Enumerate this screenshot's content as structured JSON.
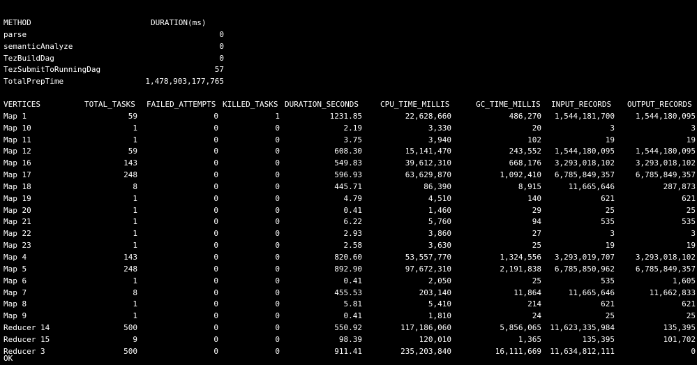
{
  "method_table": {
    "headers": {
      "method": "METHOD",
      "duration": "DURATION(ms)"
    },
    "rows": [
      {
        "method": "parse",
        "duration": "0"
      },
      {
        "method": "semanticAnalyze",
        "duration": "0"
      },
      {
        "method": "TezBuildDag",
        "duration": "0"
      },
      {
        "method": "TezSubmitToRunningDag",
        "duration": "57"
      },
      {
        "method": "TotalPrepTime",
        "duration": "1,478,903,177,765"
      }
    ]
  },
  "vertex_table": {
    "headers": {
      "vertices": "VERTICES",
      "total_tasks": "TOTAL_TASKS",
      "failed_attempts": "FAILED_ATTEMPTS",
      "killed_tasks": "KILLED_TASKS",
      "duration_seconds": "DURATION_SECONDS",
      "cpu_time_millis": "CPU_TIME_MILLIS",
      "gc_time_millis": "GC_TIME_MILLIS",
      "input_records": "INPUT_RECORDS",
      "output_records": "OUTPUT_RECORDS"
    },
    "rows": [
      {
        "vertex": "Map 1",
        "total_tasks": "59",
        "failed_attempts": "0",
        "killed_tasks": "1",
        "duration_seconds": "1231.85",
        "cpu_time_millis": "22,628,660",
        "gc_time_millis": "486,270",
        "input_records": "1,544,181,700",
        "output_records": "1,544,180,095"
      },
      {
        "vertex": "Map 10",
        "total_tasks": "1",
        "failed_attempts": "0",
        "killed_tasks": "0",
        "duration_seconds": "2.19",
        "cpu_time_millis": "3,330",
        "gc_time_millis": "20",
        "input_records": "3",
        "output_records": "3"
      },
      {
        "vertex": "Map 11",
        "total_tasks": "1",
        "failed_attempts": "0",
        "killed_tasks": "0",
        "duration_seconds": "3.75",
        "cpu_time_millis": "3,940",
        "gc_time_millis": "102",
        "input_records": "19",
        "output_records": "19"
      },
      {
        "vertex": "Map 12",
        "total_tasks": "59",
        "failed_attempts": "0",
        "killed_tasks": "0",
        "duration_seconds": "608.30",
        "cpu_time_millis": "15,141,470",
        "gc_time_millis": "243,552",
        "input_records": "1,544,180,095",
        "output_records": "1,544,180,095"
      },
      {
        "vertex": "Map 16",
        "total_tasks": "143",
        "failed_attempts": "0",
        "killed_tasks": "0",
        "duration_seconds": "549.83",
        "cpu_time_millis": "39,612,310",
        "gc_time_millis": "668,176",
        "input_records": "3,293,018,102",
        "output_records": "3,293,018,102"
      },
      {
        "vertex": "Map 17",
        "total_tasks": "248",
        "failed_attempts": "0",
        "killed_tasks": "0",
        "duration_seconds": "596.93",
        "cpu_time_millis": "63,629,870",
        "gc_time_millis": "1,092,410",
        "input_records": "6,785,849,357",
        "output_records": "6,785,849,357"
      },
      {
        "vertex": "Map 18",
        "total_tasks": "8",
        "failed_attempts": "0",
        "killed_tasks": "0",
        "duration_seconds": "445.71",
        "cpu_time_millis": "86,390",
        "gc_time_millis": "8,915",
        "input_records": "11,665,646",
        "output_records": "287,873"
      },
      {
        "vertex": "Map 19",
        "total_tasks": "1",
        "failed_attempts": "0",
        "killed_tasks": "0",
        "duration_seconds": "4.79",
        "cpu_time_millis": "4,510",
        "gc_time_millis": "140",
        "input_records": "621",
        "output_records": "621"
      },
      {
        "vertex": "Map 20",
        "total_tasks": "1",
        "failed_attempts": "0",
        "killed_tasks": "0",
        "duration_seconds": "0.41",
        "cpu_time_millis": "1,460",
        "gc_time_millis": "29",
        "input_records": "25",
        "output_records": "25"
      },
      {
        "vertex": "Map 21",
        "total_tasks": "1",
        "failed_attempts": "0",
        "killed_tasks": "0",
        "duration_seconds": "6.22",
        "cpu_time_millis": "5,760",
        "gc_time_millis": "94",
        "input_records": "535",
        "output_records": "535"
      },
      {
        "vertex": "Map 22",
        "total_tasks": "1",
        "failed_attempts": "0",
        "killed_tasks": "0",
        "duration_seconds": "2.93",
        "cpu_time_millis": "3,860",
        "gc_time_millis": "27",
        "input_records": "3",
        "output_records": "3"
      },
      {
        "vertex": "Map 23",
        "total_tasks": "1",
        "failed_attempts": "0",
        "killed_tasks": "0",
        "duration_seconds": "2.58",
        "cpu_time_millis": "3,630",
        "gc_time_millis": "25",
        "input_records": "19",
        "output_records": "19"
      },
      {
        "vertex": "Map 4",
        "total_tasks": "143",
        "failed_attempts": "0",
        "killed_tasks": "0",
        "duration_seconds": "820.60",
        "cpu_time_millis": "53,557,770",
        "gc_time_millis": "1,324,556",
        "input_records": "3,293,019,707",
        "output_records": "3,293,018,102"
      },
      {
        "vertex": "Map 5",
        "total_tasks": "248",
        "failed_attempts": "0",
        "killed_tasks": "0",
        "duration_seconds": "892.90",
        "cpu_time_millis": "97,672,310",
        "gc_time_millis": "2,191,838",
        "input_records": "6,785,850,962",
        "output_records": "6,785,849,357"
      },
      {
        "vertex": "Map 6",
        "total_tasks": "1",
        "failed_attempts": "0",
        "killed_tasks": "0",
        "duration_seconds": "0.41",
        "cpu_time_millis": "2,050",
        "gc_time_millis": "25",
        "input_records": "535",
        "output_records": "1,605"
      },
      {
        "vertex": "Map 7",
        "total_tasks": "8",
        "failed_attempts": "0",
        "killed_tasks": "0",
        "duration_seconds": "455.53",
        "cpu_time_millis": "203,140",
        "gc_time_millis": "11,864",
        "input_records": "11,665,646",
        "output_records": "11,662,833"
      },
      {
        "vertex": "Map 8",
        "total_tasks": "1",
        "failed_attempts": "0",
        "killed_tasks": "0",
        "duration_seconds": "5.81",
        "cpu_time_millis": "5,410",
        "gc_time_millis": "214",
        "input_records": "621",
        "output_records": "621"
      },
      {
        "vertex": "Map 9",
        "total_tasks": "1",
        "failed_attempts": "0",
        "killed_tasks": "0",
        "duration_seconds": "0.41",
        "cpu_time_millis": "1,810",
        "gc_time_millis": "24",
        "input_records": "25",
        "output_records": "25"
      },
      {
        "vertex": "Reducer 14",
        "total_tasks": "500",
        "failed_attempts": "0",
        "killed_tasks": "0",
        "duration_seconds": "550.92",
        "cpu_time_millis": "117,186,060",
        "gc_time_millis": "5,856,065",
        "input_records": "11,623,335,984",
        "output_records": "135,395"
      },
      {
        "vertex": "Reducer 15",
        "total_tasks": "9",
        "failed_attempts": "0",
        "killed_tasks": "0",
        "duration_seconds": "98.39",
        "cpu_time_millis": "120,010",
        "gc_time_millis": "1,365",
        "input_records": "135,395",
        "output_records": "101,702"
      },
      {
        "vertex": "Reducer 3",
        "total_tasks": "500",
        "failed_attempts": "0",
        "killed_tasks": "0",
        "duration_seconds": "911.41",
        "cpu_time_millis": "235,203,840",
        "gc_time_millis": "16,111,669",
        "input_records": "11,634,812,111",
        "output_records": "0"
      }
    ]
  },
  "status": "OK"
}
